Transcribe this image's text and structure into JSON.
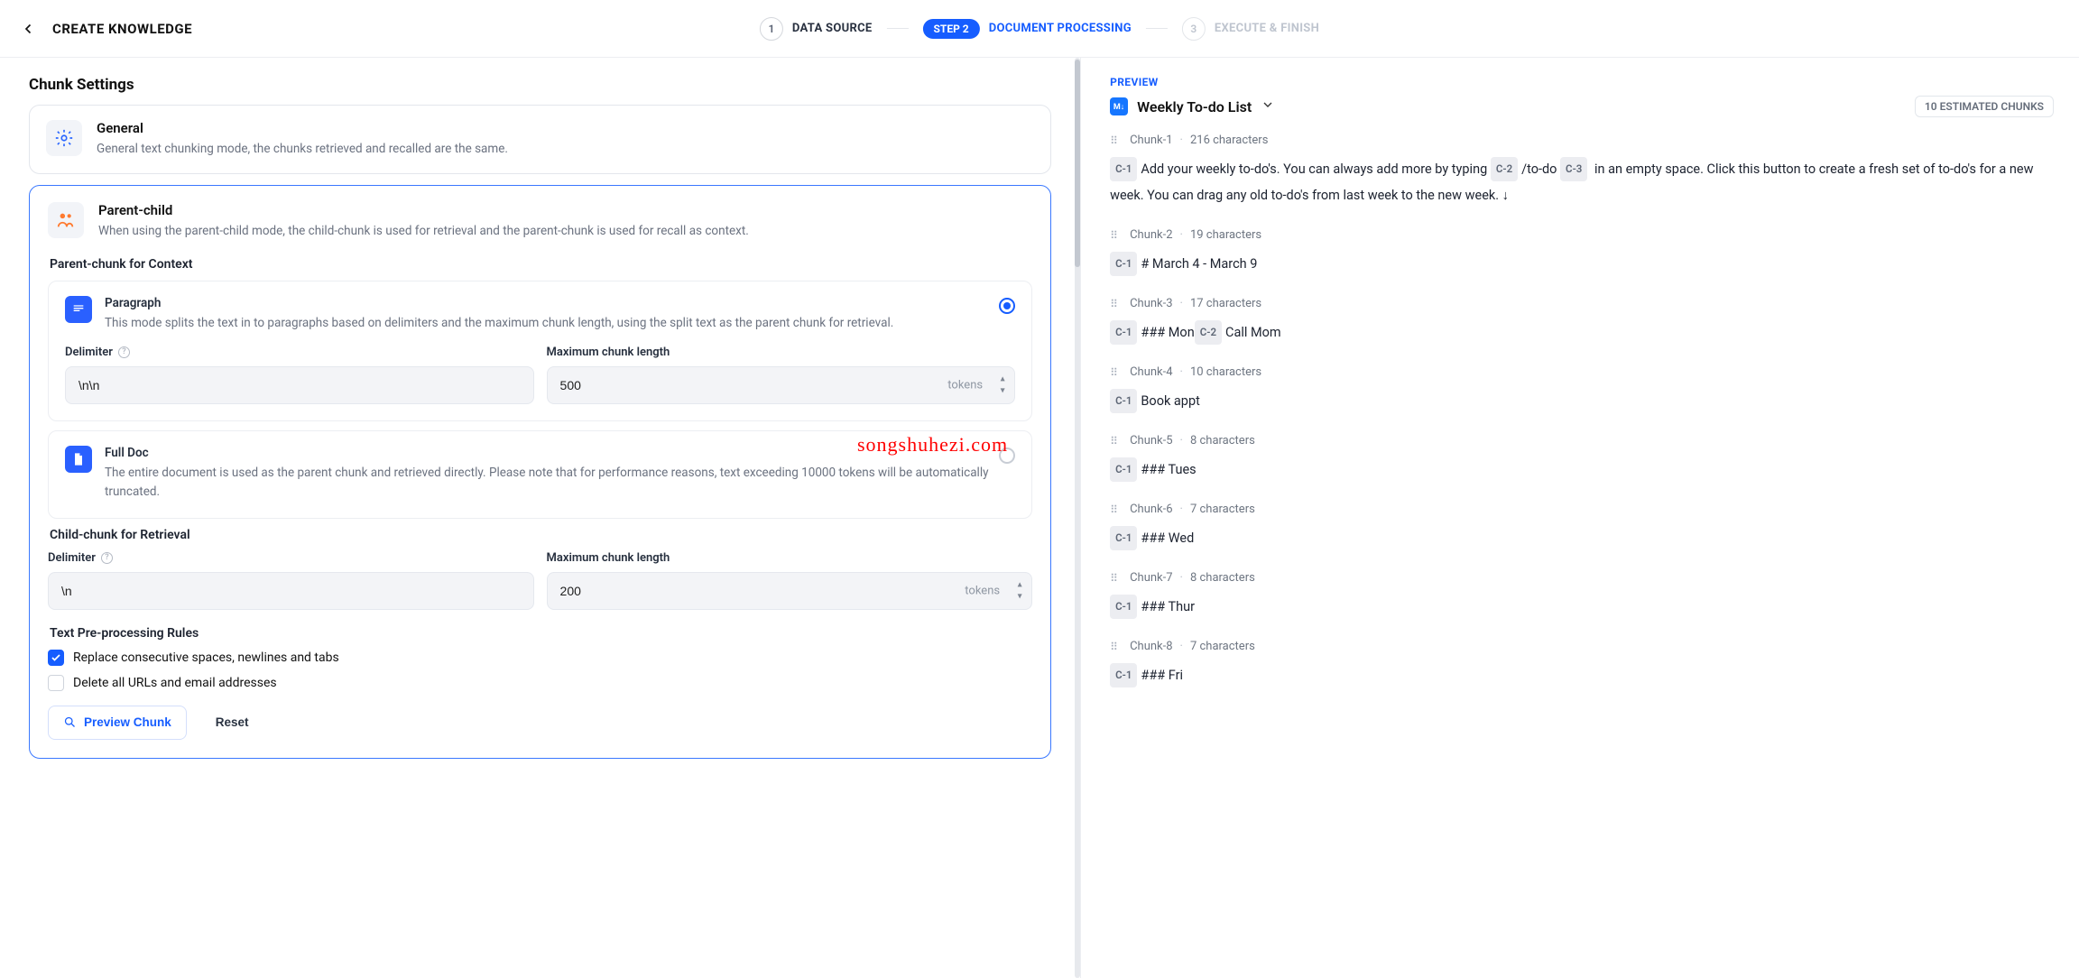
{
  "header": {
    "title": "CREATE KNOWLEDGE",
    "steps": [
      {
        "num": "1",
        "label": "DATA SOURCE"
      },
      {
        "pill": "STEP 2",
        "label": "DOCUMENT PROCESSING"
      },
      {
        "num": "3",
        "label": "EXECUTE & FINISH"
      }
    ]
  },
  "settings": {
    "heading": "Chunk Settings",
    "general": {
      "title": "General",
      "desc": "General text chunking mode, the chunks retrieved and recalled are the same."
    },
    "parent_child": {
      "title": "Parent-child",
      "desc": "When using the parent-child mode, the child-chunk is used for retrieval and the parent-chunk is used for recall as context."
    },
    "pc_section": "Parent-chunk for Context",
    "paragraph": {
      "title": "Paragraph",
      "desc": "This mode splits the text in to paragraphs based on delimiters and the maximum chunk length, using the split text as the parent chunk for retrieval.",
      "selected": true,
      "delimiter": {
        "label": "Delimiter",
        "value": "\\n\\n"
      },
      "max": {
        "label": "Maximum chunk length",
        "value": "500",
        "unit": "tokens"
      }
    },
    "fulldoc": {
      "title": "Full Doc",
      "desc": "The entire document is used as the parent chunk and retrieved directly. Please note that for performance reasons, text exceeding 10000 tokens will be automatically truncated.",
      "selected": false
    },
    "child_section": "Child-chunk for Retrieval",
    "child_delimiter": {
      "label": "Delimiter",
      "value": "\\n"
    },
    "child_max": {
      "label": "Maximum chunk length",
      "value": "200",
      "unit": "tokens"
    },
    "rules": {
      "heading": "Text Pre-processing Rules",
      "r1": "Replace consecutive spaces, newlines and tabs",
      "r2": "Delete all URLs and email addresses",
      "r1_on": true,
      "r2_on": false
    },
    "buttons": {
      "preview": "Preview Chunk",
      "reset": "Reset"
    }
  },
  "preview": {
    "label": "PREVIEW",
    "file": "Weekly To-do List",
    "badge": "10 ESTIMATED CHUNKS",
    "chunks": [
      {
        "id": "Chunk-1",
        "chars": "216 characters",
        "parts": [
          {
            "t": "C-1",
            "x": "Add your weekly to-do's. You can always add more by typing "
          },
          {
            "t": "C-2",
            "x": "/to-do "
          },
          {
            "t": "C-3",
            "x": " in an empty space. Click this button to create a fresh set of to-do's for a new week. You can drag any old to-do's from last week to the new week. ↓"
          }
        ]
      },
      {
        "id": "Chunk-2",
        "chars": "19 characters",
        "parts": [
          {
            "t": "C-1",
            "x": "# March 4 - March 9"
          }
        ]
      },
      {
        "id": "Chunk-3",
        "chars": "17 characters",
        "parts": [
          {
            "t": "C-1",
            "x": "### Mon"
          },
          {
            "t": "C-2",
            "x": "Call Mom"
          }
        ]
      },
      {
        "id": "Chunk-4",
        "chars": "10 characters",
        "parts": [
          {
            "t": "C-1",
            "x": "Book appt"
          }
        ]
      },
      {
        "id": "Chunk-5",
        "chars": "8 characters",
        "parts": [
          {
            "t": "C-1",
            "x": "### Tues"
          }
        ]
      },
      {
        "id": "Chunk-6",
        "chars": "7 characters",
        "parts": [
          {
            "t": "C-1",
            "x": "### Wed"
          }
        ]
      },
      {
        "id": "Chunk-7",
        "chars": "8 characters",
        "parts": [
          {
            "t": "C-1",
            "x": "### Thur"
          }
        ]
      },
      {
        "id": "Chunk-8",
        "chars": "7 characters",
        "parts": [
          {
            "t": "C-1",
            "x": "### Fri"
          }
        ]
      }
    ]
  },
  "watermark": "songshuhezi.com"
}
